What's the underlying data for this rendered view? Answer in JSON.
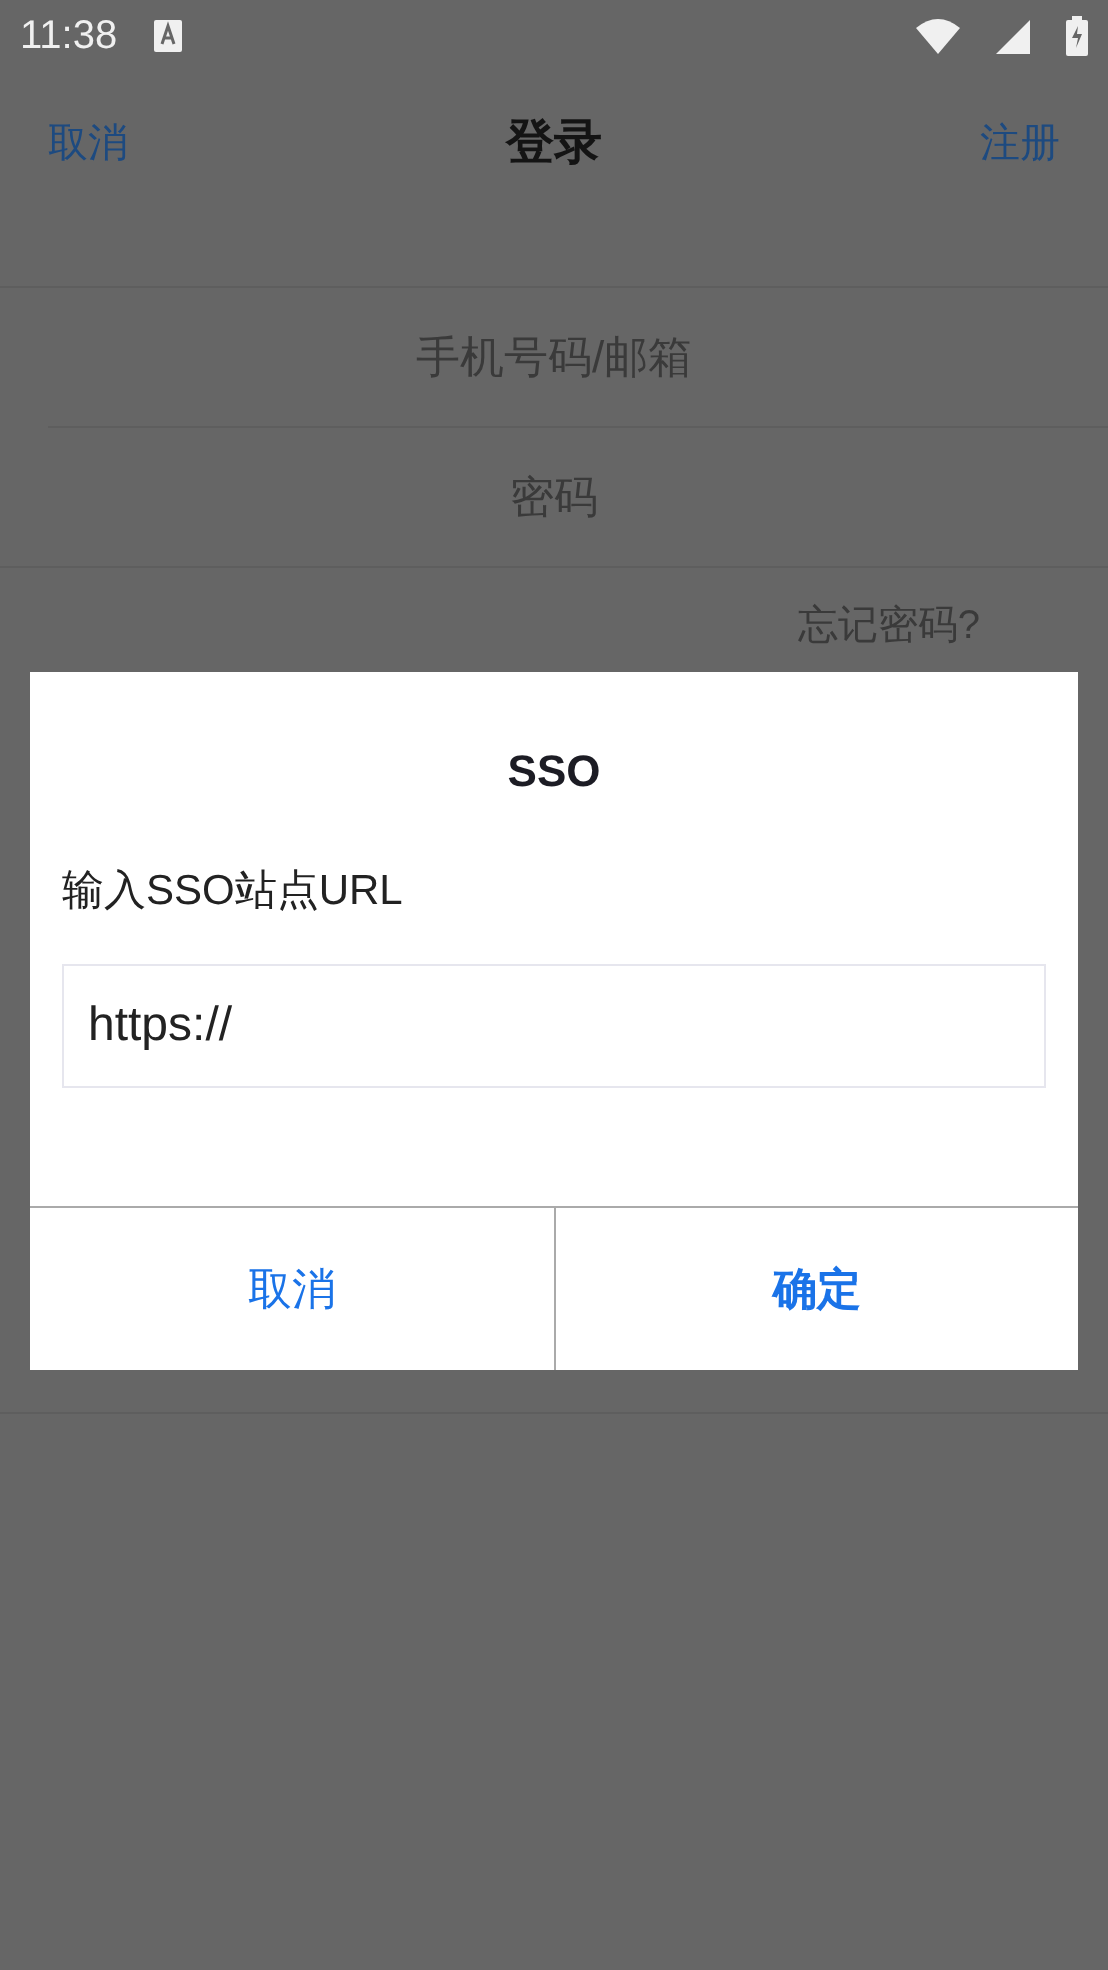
{
  "status_bar": {
    "time": "11:38"
  },
  "nav": {
    "left": "取消",
    "title": "登录",
    "right": "注册"
  },
  "form": {
    "fields": [
      {
        "placeholder": "手机号码/邮箱"
      },
      {
        "placeholder": "密码"
      }
    ],
    "forgot_password": "忘记密码?"
  },
  "dialog": {
    "title": "SSO",
    "label": "输入SSO站点URL",
    "input": {
      "value": "https://"
    },
    "buttons": [
      {
        "label": "取消",
        "primary": false
      },
      {
        "label": "确定",
        "primary": true
      }
    ]
  }
}
